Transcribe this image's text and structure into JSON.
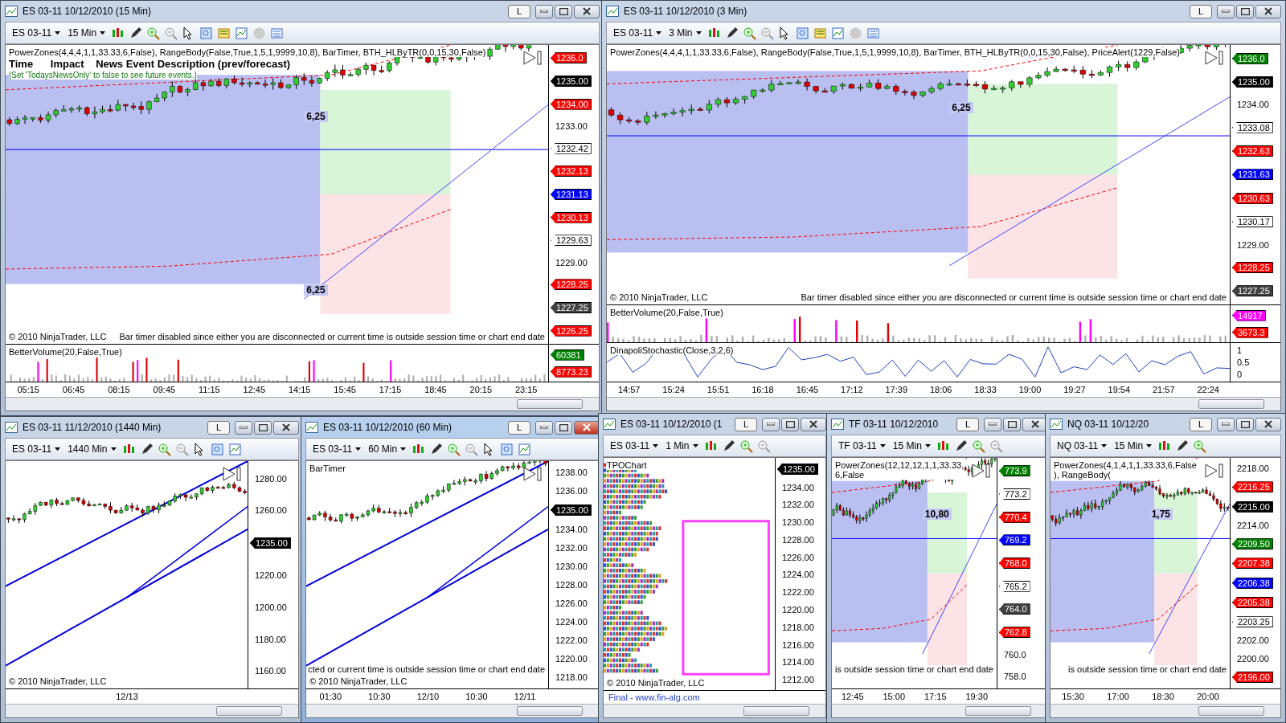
{
  "windows": [
    {
      "title": "ES 03-11  10/12/2010 (15 Min)",
      "link": "L",
      "active": false,
      "symbol": "ES 03-11",
      "interval": "15 Min",
      "tools": [
        {
          "kind": "candles"
        },
        {
          "kind": "pencil"
        },
        {
          "kind": "zoom-in"
        },
        {
          "kind": "zoom-out"
        },
        {
          "kind": "cursor"
        },
        {
          "kind": "properties"
        },
        {
          "kind": "data-box"
        },
        {
          "kind": "chart-trader"
        },
        {
          "kind": "dollar"
        },
        {
          "kind": "list"
        }
      ],
      "texts": [
        {
          "kind": "indicator",
          "text": "PowerZones(4,4,4,1,1,33.33,6,False), RangeBody(False,True,1,5,1,9999,10,8), BarTimer, BTH_HLByTR(0,0,15,30,False)"
        },
        {
          "kind": "header",
          "text": "Time      Impact    News Event Description (prev/forecast)"
        },
        {
          "kind": "note",
          "text": "(Set 'TodaysNewsOnly' to false to see future events.)"
        }
      ],
      "markers": [
        "6,25",
        "6,25"
      ],
      "copyright": "© 2010 NinjaTrader, LLC",
      "message": "Bar timer disabled since either you are disconnected or current time is outside session time or chart end date",
      "panes": [
        {
          "kind": "price",
          "axis": [
            {
              "text": "1236.0",
              "color": "#ff0000"
            },
            {
              "text": "1235.00",
              "color": "#000000"
            },
            {
              "text": "1234.00",
              "color": "#ff0000"
            },
            {
              "text": "1233.00"
            },
            {
              "text": "1232.42",
              "color": "#ffffff"
            },
            {
              "text": "1232.13",
              "color": "#ff0000"
            },
            {
              "text": "1231.13",
              "color": "#0000ff"
            },
            {
              "text": "1230.13",
              "color": "#ff0000"
            },
            {
              "text": "1229.63",
              "color": "#ffffff"
            },
            {
              "text": "1229.00"
            },
            {
              "text": "1228.25",
              "color": "#ff0000"
            },
            {
              "text": "1227.25",
              "color": "#404040"
            },
            {
              "text": "1226.25",
              "color": "#ff0000"
            }
          ]
        },
        {
          "kind": "volume",
          "label": "BetterVolume(20,False,True)",
          "axis": [
            {
              "text": "60381",
              "color": "#008000"
            },
            {
              "text": "8773.23",
              "color": "#ff0000"
            }
          ]
        }
      ],
      "times": [
        "05:15",
        "06:45",
        "08:15",
        "09:45",
        "11:15",
        "12:45",
        "14:15",
        "15:45",
        "17:15",
        "18:45",
        "20:15",
        "23:15"
      ]
    },
    {
      "title": "ES 03-11  10/12/2010 (3 Min)",
      "link": "L",
      "active": false,
      "symbol": "ES 03-11",
      "interval": "3 Min",
      "tools": [
        {
          "kind": "candles"
        },
        {
          "kind": "pencil"
        },
        {
          "kind": "zoom-in"
        },
        {
          "kind": "zoom-out"
        },
        {
          "kind": "cursor"
        },
        {
          "kind": "properties"
        },
        {
          "kind": "data-box"
        },
        {
          "kind": "chart-trader"
        },
        {
          "kind": "dollar"
        },
        {
          "kind": "list"
        }
      ],
      "texts": [
        {
          "kind": "indicator",
          "text": "PowerZones(4,4,4,1,1,33.33,6,False), RangeBody(False,True,1,5,1,9999,10,8), BarTimer, BTH_HLByTR(0,0,15,30,False), PriceAlert(1229,False)"
        }
      ],
      "markers": [
        "6,25"
      ],
      "copyright": "© 2010 NinjaTrader, LLC",
      "message": "Bar timer disabled since either you are disconnected or current time is outside session time or chart end date",
      "panes": [
        {
          "kind": "price",
          "axis": [
            {
              "text": "1236.0",
              "color": "#008000"
            },
            {
              "text": "1235.00",
              "color": "#000000"
            },
            {
              "text": "1234.00"
            },
            {
              "text": "1233.08",
              "color": "#ffffff"
            },
            {
              "text": "1232.63",
              "color": "#ff0000"
            },
            {
              "text": "1231.63",
              "color": "#0000ff"
            },
            {
              "text": "1230.63",
              "color": "#ff0000"
            },
            {
              "text": "1230.17",
              "color": "#ffffff"
            },
            {
              "text": "1229.00"
            },
            {
              "text": "1228.25",
              "color": "#ff0000"
            },
            {
              "text": "1227.25",
              "color": "#404040"
            }
          ]
        },
        {
          "kind": "volume",
          "label": "BetterVolume(20,False,True)",
          "axis": [
            {
              "text": "14917",
              "color": "#ff00ff"
            },
            {
              "text": "3673.3",
              "color": "#ff0000"
            }
          ]
        },
        {
          "kind": "oscillator",
          "label": "DinapoliStochastic(Close,3,2,6)",
          "axis": [
            {
              "text": "1"
            },
            {
              "text": "0.5"
            },
            {
              "text": "0"
            }
          ]
        }
      ],
      "times": [
        "14:57",
        "15:24",
        "15:51",
        "16:18",
        "16:45",
        "17:12",
        "17:39",
        "18:06",
        "18:33",
        "19:00",
        "19:27",
        "19:54",
        "21:57",
        "22:24"
      ]
    },
    {
      "title": "ES 03-11  11/12/2010 (1440 Min)",
      "link": "L",
      "active": false,
      "symbol": "ES 03-11",
      "interval": "1440 Min",
      "tools": [
        {
          "kind": "candles"
        },
        {
          "kind": "pencil"
        },
        {
          "kind": "zoom-in"
        },
        {
          "kind": "zoom-out"
        },
        {
          "kind": "cursor"
        },
        {
          "kind": "properties"
        },
        {
          "kind": "chart-trader"
        }
      ],
      "copyright": "© 2010 NinjaTrader, LLC",
      "panes": [
        {
          "kind": "trend",
          "axis": [
            {
              "text": "1280.00"
            },
            {
              "text": "1260.00"
            },
            {
              "text": "1235.00",
              "color": "#000000"
            },
            {
              "text": "1220.00"
            },
            {
              "text": "1200.00"
            },
            {
              "text": "1180.00"
            },
            {
              "text": "1160.00"
            }
          ]
        }
      ],
      "times": [
        "12/13"
      ]
    },
    {
      "title": "ES 03-11  10/12/2010 (60 Min)",
      "link": "L",
      "active": true,
      "symbol": "ES 03-11",
      "interval": "60 Min",
      "tools": [
        {
          "kind": "candles"
        },
        {
          "kind": "pencil"
        },
        {
          "kind": "zoom-in"
        },
        {
          "kind": "zoom-out"
        },
        {
          "kind": "cursor"
        },
        {
          "kind": "properties"
        },
        {
          "kind": "chart-trader"
        }
      ],
      "texts": [
        {
          "kind": "indicator",
          "text": "BarTimer"
        }
      ],
      "copyright": "© 2010 NinjaTrader, LLC",
      "message": "cted or current time is outside session time or chart end date",
      "panes": [
        {
          "kind": "trend",
          "axis": [
            {
              "text": "1238.00"
            },
            {
              "text": "1236.00"
            },
            {
              "text": "1235.00",
              "color": "#000000"
            },
            {
              "text": "1234.00"
            },
            {
              "text": "1232.00"
            },
            {
              "text": "1230.00"
            },
            {
              "text": "1228.00"
            },
            {
              "text": "1226.00"
            },
            {
              "text": "1224.00"
            },
            {
              "text": "1222.00"
            },
            {
              "text": "1220.00"
            },
            {
              "text": "1218.00"
            }
          ]
        }
      ],
      "times": [
        "01:30",
        "10:30",
        "12/10",
        "10:30",
        "12/11"
      ]
    },
    {
      "title": "ES 03-11  10/12/2010 (1",
      "link": "L",
      "active": false,
      "symbol": "ES 03-11",
      "interval": "1 Min",
      "tools": [
        {
          "kind": "candles"
        },
        {
          "kind": "pencil"
        },
        {
          "kind": "zoom-in"
        },
        {
          "kind": "zoom-out"
        }
      ],
      "texts": [
        {
          "kind": "indicator",
          "text": "TPOChart"
        }
      ],
      "copyright": "© 2010 NinjaTrader, LLC",
      "footer": "Final - www.fin-alg.com",
      "panes": [
        {
          "kind": "tpo",
          "axis": [
            {
              "text": "1235.00",
              "color": "#000000"
            },
            {
              "text": "1234.00"
            },
            {
              "text": "1232.00"
            },
            {
              "text": "1230.00"
            },
            {
              "text": "1228.00"
            },
            {
              "text": "1226.00"
            },
            {
              "text": "1224.00"
            },
            {
              "text": "1222.00"
            },
            {
              "text": "1220.00"
            },
            {
              "text": "1218.00"
            },
            {
              "text": "1216.00"
            },
            {
              "text": "1214.00"
            },
            {
              "text": "1212.00"
            }
          ]
        }
      ]
    },
    {
      "title": "TF 03-11  10/12/2010",
      "link": "L",
      "active": false,
      "symbol": "TF 03-11",
      "interval": "15 Min",
      "tools": [
        {
          "kind": "candles"
        },
        {
          "kind": "pencil"
        },
        {
          "kind": "zoom-in"
        },
        {
          "kind": "zoom-out"
        }
      ],
      "texts": [
        {
          "kind": "indicator",
          "text": "PowerZones(12,12,12,1,1,33.33,6,False"
        }
      ],
      "markers": [
        "10,80"
      ],
      "message": "is outside session time or chart end date",
      "panes": [
        {
          "kind": "price",
          "axis": [
            {
              "text": "773.9",
              "color": "#008000"
            },
            {
              "text": "773.2",
              "color": "#ffffff"
            },
            {
              "text": "770.4",
              "color": "#ff0000"
            },
            {
              "text": "769.2",
              "color": "#0000ff"
            },
            {
              "text": "768.0",
              "color": "#ff0000"
            },
            {
              "text": "765.2",
              "color": "#ffffff"
            },
            {
              "text": "764.0",
              "color": "#404040"
            },
            {
              "text": "762.8",
              "color": "#ff0000"
            },
            {
              "text": "760.0"
            },
            {
              "text": "758.0"
            }
          ]
        }
      ],
      "times": [
        "12:45",
        "15:00",
        "17:15",
        "19:30"
      ]
    },
    {
      "title": "NQ 03-11  10/12/20",
      "link": "L",
      "active": false,
      "symbol": "NQ 03-11",
      "interval": "15 Min",
      "tools": [
        {
          "kind": "candles"
        },
        {
          "kind": "pencil"
        },
        {
          "kind": "zoom-in"
        }
      ],
      "texts": [
        {
          "kind": "indicator",
          "text": "PowerZones(4,1,4,1,1,33.33,6,False), RangeBody("
        }
      ],
      "markers": [
        "1,75"
      ],
      "message": "is outside session time or chart end date",
      "panes": [
        {
          "kind": "price",
          "axis": [
            {
              "text": "2218.00"
            },
            {
              "text": "2216.25",
              "color": "#ff0000"
            },
            {
              "text": "2215.00",
              "color": "#000000"
            },
            {
              "text": "2214.00"
            },
            {
              "text": "2209.50",
              "color": "#008000"
            },
            {
              "text": "2207.38",
              "color": "#ff0000"
            },
            {
              "text": "2206.38",
              "color": "#0000ff"
            },
            {
              "text": "2205.38",
              "color": "#ff0000"
            },
            {
              "text": "2203.25",
              "color": "#ffffff"
            },
            {
              "text": "2202.00"
            },
            {
              "text": "2200.00"
            },
            {
              "text": "2196.00",
              "color": "#ff0000"
            }
          ]
        }
      ],
      "times": [
        "15:30",
        "17:00",
        "18:30",
        "20:00"
      ]
    }
  ]
}
